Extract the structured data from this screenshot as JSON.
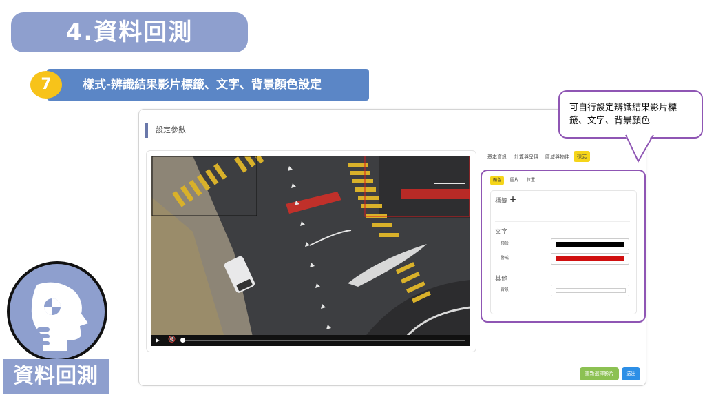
{
  "slide": {
    "title": "4.資料回測",
    "step_number": "7",
    "step_title": "樣式-辨識結果影片標籤、文字、背景顏色設定",
    "callout_text": "可自行設定辨識結果影片標籤、文字、背景顏色",
    "bottom_label": "資料回測"
  },
  "panel": {
    "header": "設定參數",
    "tabs": [
      "基本資訊",
      "計算與呈現",
      "區域與物件",
      "樣式"
    ],
    "active_tab": "樣式",
    "subtabs": [
      "顏色",
      "圖片",
      "位置"
    ],
    "active_subtab": "顏色",
    "section_label": "標籤",
    "text_section": "文字",
    "text_rows": [
      {
        "label": "預設",
        "color": "#000000"
      },
      {
        "label": "警戒",
        "color": "#d01010"
      }
    ],
    "other_section": "其他",
    "other_rows": [
      {
        "label": "背景",
        "color": "#ffffff"
      }
    ],
    "buttons": {
      "reselect": "重新選擇影片",
      "finish": "送出"
    }
  },
  "colors": {
    "accent_purple": "#8f56b4",
    "title_blue": "#8e9fce",
    "step_blue": "#5b86c6",
    "tab_yellow": "#f5d51a",
    "btn_green": "#8cc152",
    "btn_blue": "#2d8fe6"
  },
  "video": {
    "progress_fraction": 0.0
  }
}
